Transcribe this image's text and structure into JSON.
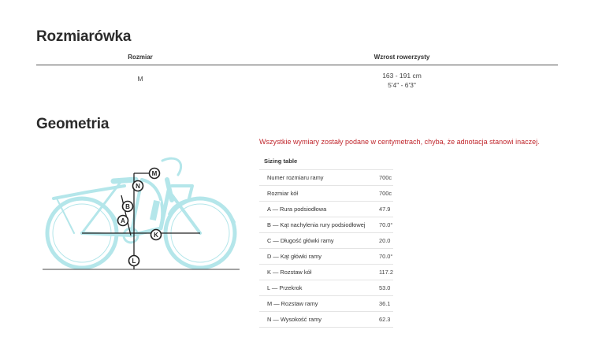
{
  "sizing": {
    "title": "Rozmiarówka",
    "headers": {
      "size": "Rozmiar",
      "height": "Wzrost rowerzysty"
    },
    "rows": [
      {
        "size": "M",
        "height_cm": "163 - 191 cm",
        "height_ft": "5'4\" - 6'3\""
      }
    ]
  },
  "geometry": {
    "title": "Geometria",
    "notice": "Wszystkie wymiary zostały podane w centymetrach, chyba, że adnotacja stanowi inaczej.",
    "table_caption": "Sizing table",
    "rows": [
      {
        "label": "Numer rozmiaru ramy",
        "value": "700c"
      },
      {
        "label": "Rozmiar kół",
        "value": "700c"
      },
      {
        "label": "A — Rura podsiodłowa",
        "value": "47.9"
      },
      {
        "label": "B — Kąt nachylenia rury podsiodłowej",
        "value": "70.0°"
      },
      {
        "label": "C — Długość główki ramy",
        "value": "20.0"
      },
      {
        "label": "D — Kąt główki ramy",
        "value": "70.0°"
      },
      {
        "label": "K — Rozstaw kół",
        "value": "117.2"
      },
      {
        "label": "L — Przekrok",
        "value": "53.0"
      },
      {
        "label": "M — Rozstaw ramy",
        "value": "36.1"
      },
      {
        "label": "N — Wysokość ramy",
        "value": "62.3"
      }
    ],
    "diagram_labels": {
      "M": "M",
      "N": "N",
      "B": "B",
      "A": "A",
      "K": "K",
      "L": "L"
    },
    "colors": {
      "bike": "#b4e6ea",
      "marker": "#222222",
      "notice": "#c0272d"
    }
  }
}
